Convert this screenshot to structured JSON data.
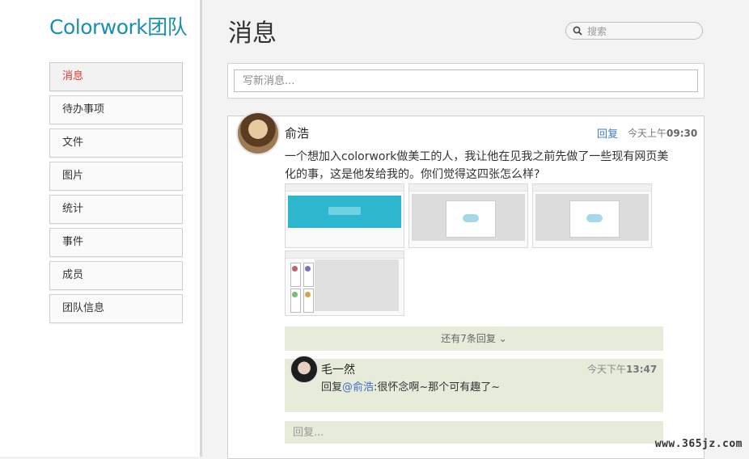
{
  "brand": "Colorwork团队",
  "nav": {
    "items": [
      {
        "label": "消息",
        "active": true
      },
      {
        "label": "待办事项"
      },
      {
        "label": "文件"
      },
      {
        "label": "图片"
      },
      {
        "label": "统计"
      },
      {
        "label": "事件"
      },
      {
        "label": "成员"
      },
      {
        "label": "团队信息"
      }
    ]
  },
  "header": {
    "title": "消息",
    "search_placeholder": "搜索"
  },
  "compose": {
    "placeholder": "写新消息..."
  },
  "post": {
    "author": "俞浩",
    "reply_label": "回复",
    "time_prefix": "今天上午",
    "time": "09:30",
    "text": "一个想加入colorwork做美工的人，我让他在见我之前先做了一些现有网页美化的事，这是他发给我的。你们觉得这四张怎么样?",
    "more_replies": "还有7条回复 ⌄",
    "reply": {
      "author": "毛一然",
      "time_prefix": "今天下午",
      "time": "13:47",
      "prefix": "回复",
      "mention": "@俞浩",
      "text": ":很怀念啊~那个可有趣了~"
    },
    "reply_placeholder": "回复..."
  },
  "watermark": "www.365jz.com",
  "colors": {
    "brand": "#1a8fb0",
    "active_nav": "#d93a2b",
    "link": "#3b7dc4",
    "reply_bg": "#e6ebda"
  }
}
